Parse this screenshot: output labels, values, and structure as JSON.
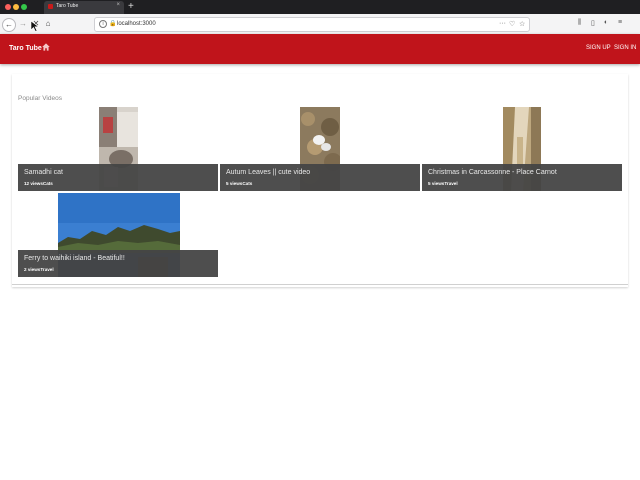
{
  "browser": {
    "tab_title": "Taro Tube",
    "url": "localhost:3000",
    "new_tab_label": "+"
  },
  "app": {
    "brand": "Taro Tube",
    "nav": {
      "sign_up": "SIGN UP",
      "sign_in": "SIGN IN"
    },
    "section_title": "Popular Videos",
    "colors": {
      "accent": "#c0141b",
      "overlay": "#444444"
    },
    "videos": [
      {
        "title": "Samadhi cat",
        "views": "12 views",
        "category": "Cats"
      },
      {
        "title": "Autum Leaves || cute video",
        "views": "5 views",
        "category": "Cats"
      },
      {
        "title": "Christmas in Carcassonne - Place Carnot",
        "views": "5 views",
        "category": "Travel"
      },
      {
        "title": "Ferry to waihiki island - Beatiful!!",
        "views": "2 views",
        "category": "Travel"
      }
    ]
  }
}
